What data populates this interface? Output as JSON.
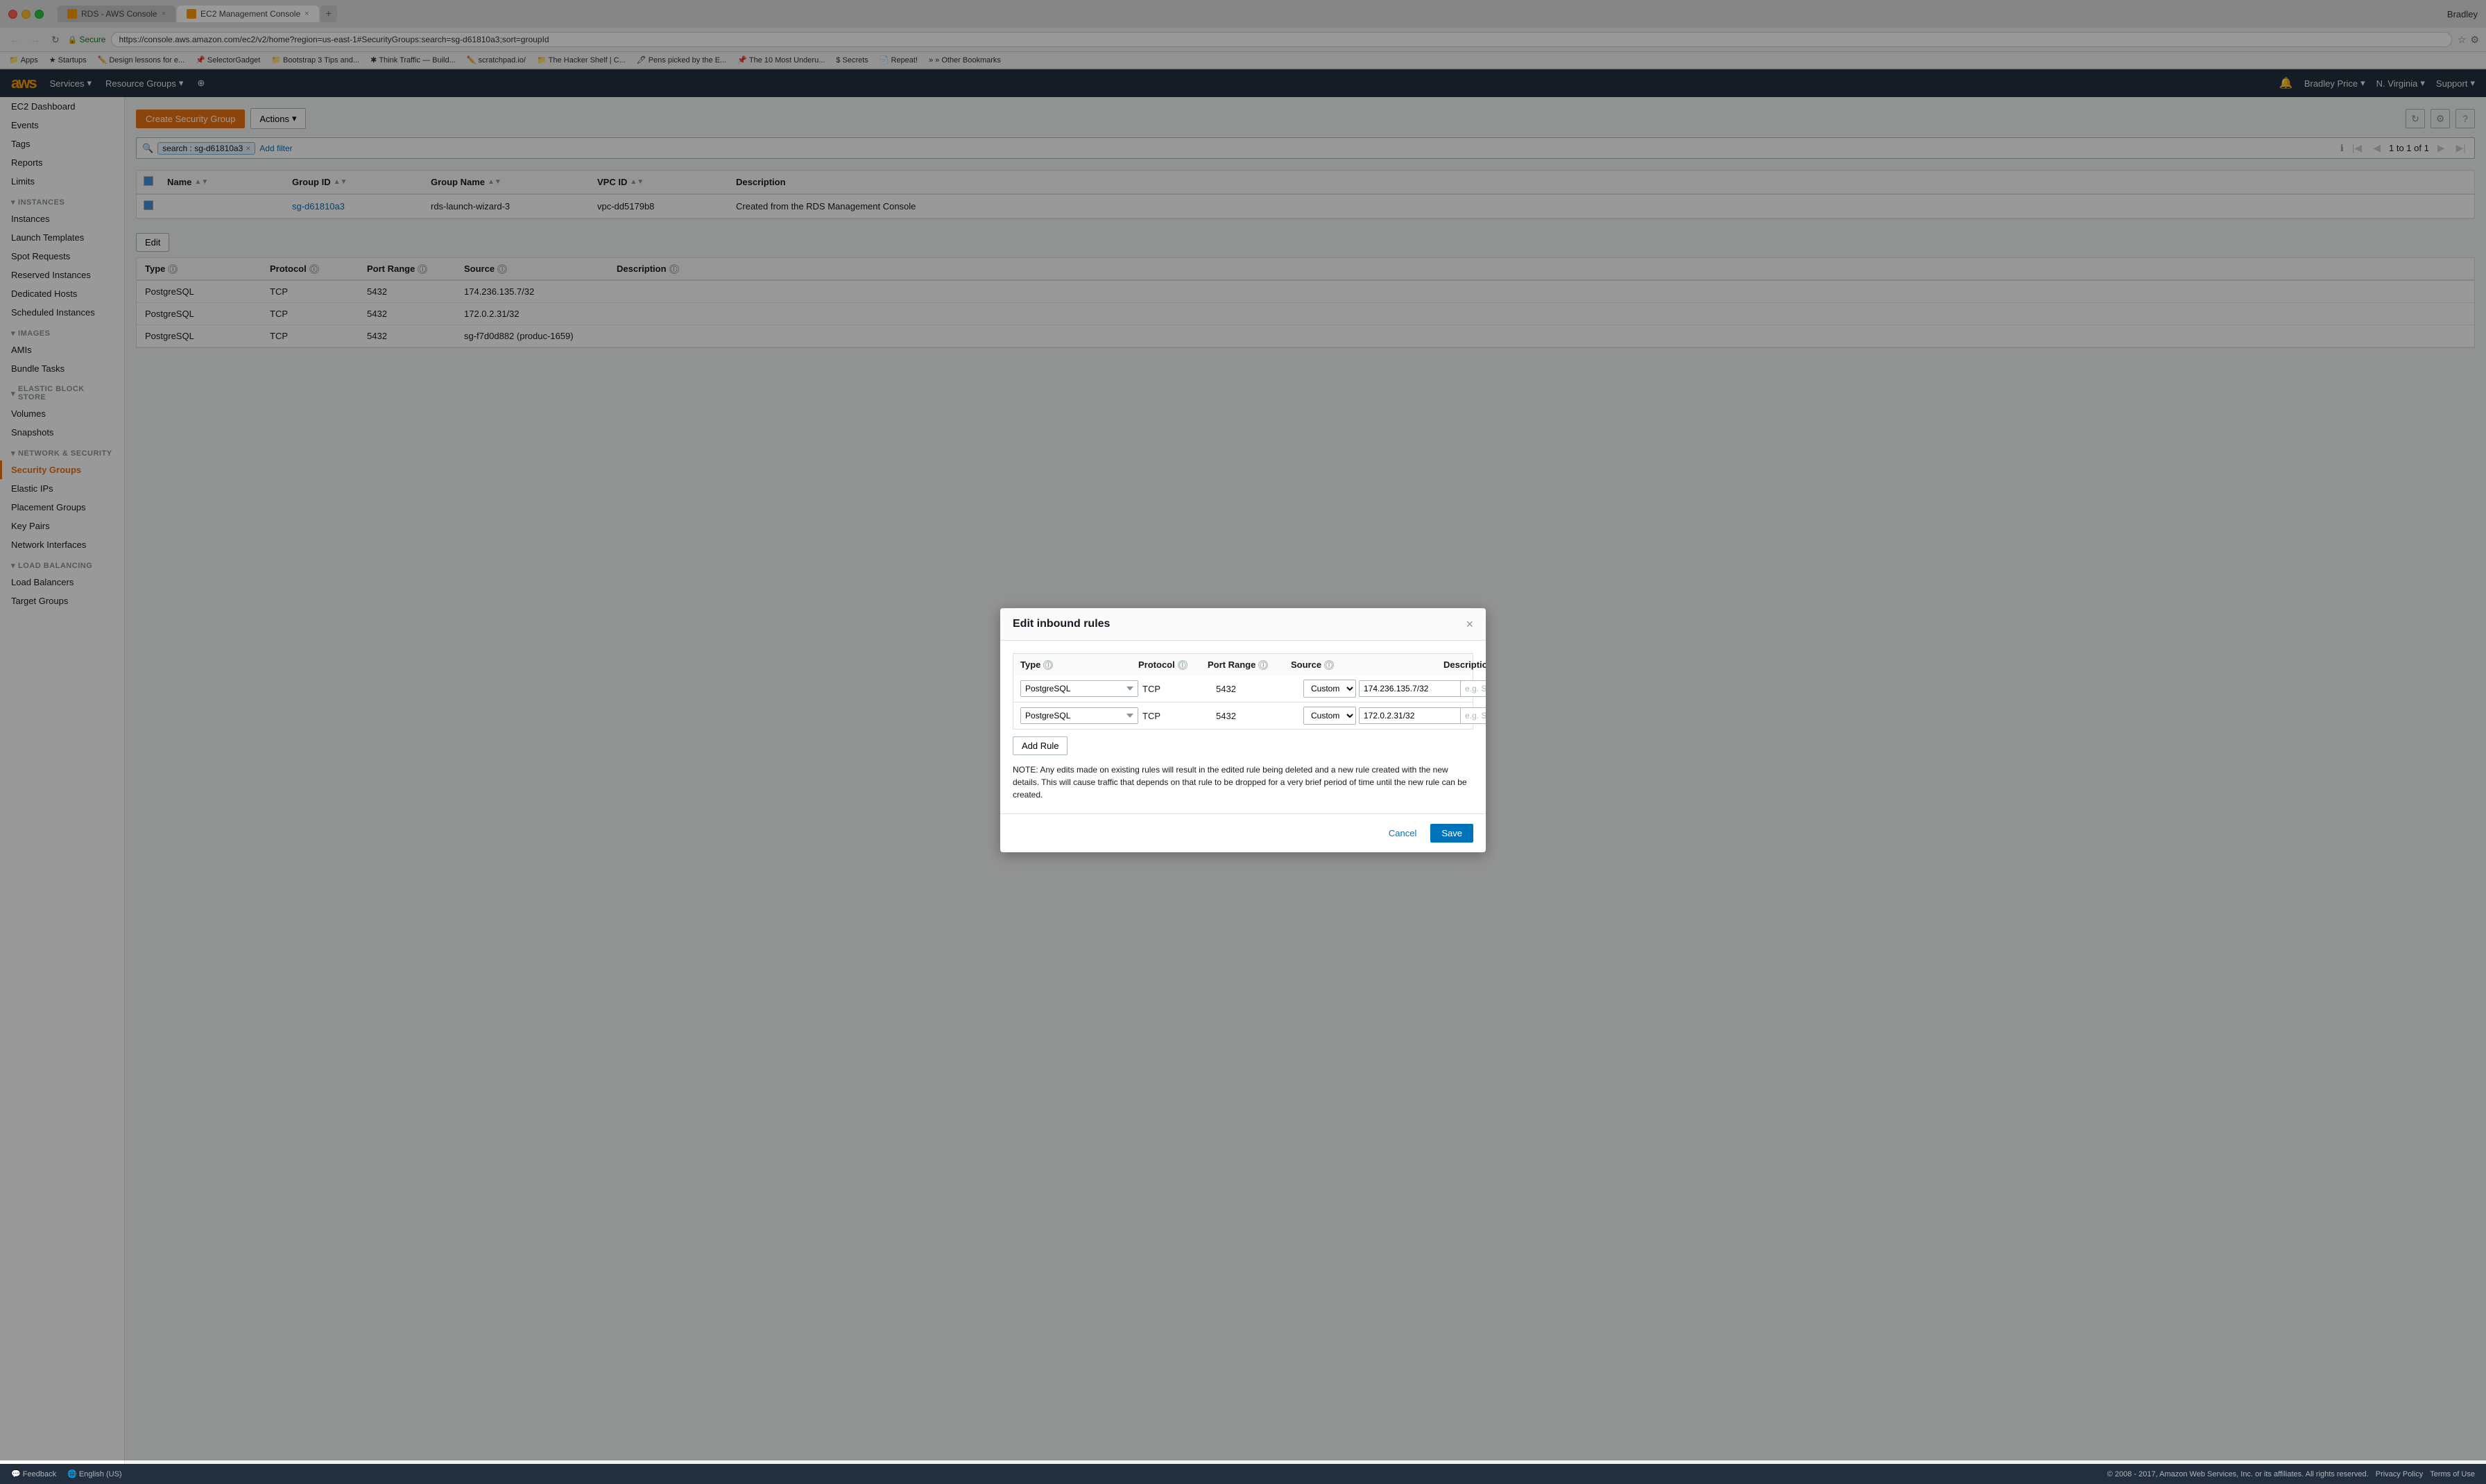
{
  "browser": {
    "user": "Bradley",
    "tabs": [
      {
        "id": "rds",
        "label": "RDS - AWS Console",
        "active": false,
        "favicon": "rds"
      },
      {
        "id": "ec2",
        "label": "EC2 Management Console",
        "active": true,
        "favicon": "ec2"
      }
    ],
    "url": "https://console.aws.amazon.com/ec2/v2/home?region=us-east-1#SecurityGroups:search=sg-d61810a3;sort=groupId",
    "bookmarks": [
      "Apps",
      "Startups",
      "Design lessons for e...",
      "SelectorGadget",
      "Bootstrap 3 Tips and...",
      "Think Traffic — Build...",
      "scratchpad.io/",
      "The Hacker Shelf | C...",
      "Pens picked by the E...",
      "The 10 Most Underu...",
      "Secrets",
      "Repeat!",
      "» Other Bookmarks"
    ]
  },
  "aws_header": {
    "services_label": "Services",
    "resource_groups_label": "Resource Groups",
    "user_label": "Bradley Price",
    "region_label": "N. Virginia",
    "support_label": "Support"
  },
  "sidebar": {
    "dashboard_label": "EC2 Dashboard",
    "events_label": "Events",
    "tags_label": "Tags",
    "reports_label": "Reports",
    "limits_label": "Limits",
    "sections": [
      {
        "id": "instances",
        "label": "INSTANCES",
        "items": [
          "Instances",
          "Launch Templates",
          "Spot Requests",
          "Reserved Instances",
          "Dedicated Hosts",
          "Scheduled Instances"
        ]
      },
      {
        "id": "images",
        "label": "IMAGES",
        "items": [
          "AMIs",
          "Bundle Tasks"
        ]
      },
      {
        "id": "ebs",
        "label": "ELASTIC BLOCK STORE",
        "items": [
          "Volumes",
          "Snapshots"
        ]
      },
      {
        "id": "network",
        "label": "NETWORK & SECURITY",
        "items": [
          "Security Groups",
          "Elastic IPs",
          "Placement Groups",
          "Key Pairs",
          "Network Interfaces"
        ]
      },
      {
        "id": "lb",
        "label": "LOAD BALANCING",
        "items": [
          "Load Balancers",
          "Target Groups"
        ]
      }
    ]
  },
  "toolbar": {
    "create_sg_label": "Create Security Group",
    "actions_label": "Actions"
  },
  "search": {
    "icon": "🔍",
    "tag_label": "search : sg-d61810a3",
    "add_filter_label": "Add filter",
    "pagination_text": "1 to 1 of 1"
  },
  "table": {
    "columns": [
      "Name",
      "Group ID",
      "Group Name",
      "VPC ID",
      "Description"
    ],
    "rows": [
      {
        "name": "",
        "group_id": "sg-d61810a3",
        "group_name": "rds-launch-wizard-3",
        "vpc_id": "vpc-dd5179b8",
        "description": "Created from the RDS Management Console"
      }
    ]
  },
  "modal": {
    "title": "Edit inbound rules",
    "close_label": "×",
    "columns": [
      "Type",
      "Protocol",
      "Port Range",
      "Source",
      "Description"
    ],
    "rows": [
      {
        "type": "PostgreSQL",
        "protocol": "TCP",
        "port_range": "5432",
        "source_type": "Custom",
        "source_value": "174.236.135.7/32",
        "description_placeholder": "e.g. SSH for Admin Desktop"
      },
      {
        "type": "PostgreSQL",
        "protocol": "TCP",
        "port_range": "5432",
        "source_type": "Custom",
        "source_value": "172.0.2.31/32",
        "description_placeholder": "e.g. SSH for Admin Desktop"
      }
    ],
    "add_rule_label": "Add Rule",
    "note": "NOTE: Any edits made on existing rules will result in the edited rule being deleted and a new rule created with the new details. This will cause traffic that depends on that rule to be dropped for a very brief period of time until the new rule can be created.",
    "cancel_label": "Cancel",
    "save_label": "Save"
  },
  "lower_section": {
    "edit_label": "Edit",
    "columns": [
      "Type",
      "Protocol",
      "Port Range",
      "Source",
      "Description"
    ],
    "rows": [
      {
        "type": "PostgreSQL",
        "protocol": "TCP",
        "port_range": "5432",
        "source": "174.236.135.7/32",
        "description": ""
      },
      {
        "type": "PostgreSQL",
        "protocol": "TCP",
        "port_range": "5432",
        "source": "172.0.2.31/32",
        "description": ""
      },
      {
        "type": "PostgreSQL",
        "protocol": "TCP",
        "port_range": "5432",
        "source": "sg-f7d0d882 (produc-1659)",
        "description": ""
      }
    ]
  },
  "footer": {
    "feedback_label": "Feedback",
    "language_label": "English (US)",
    "copyright": "© 2008 - 2017, Amazon Web Services, Inc. or its affiliates. All rights reserved.",
    "privacy_label": "Privacy Policy",
    "terms_label": "Terms of Use"
  }
}
